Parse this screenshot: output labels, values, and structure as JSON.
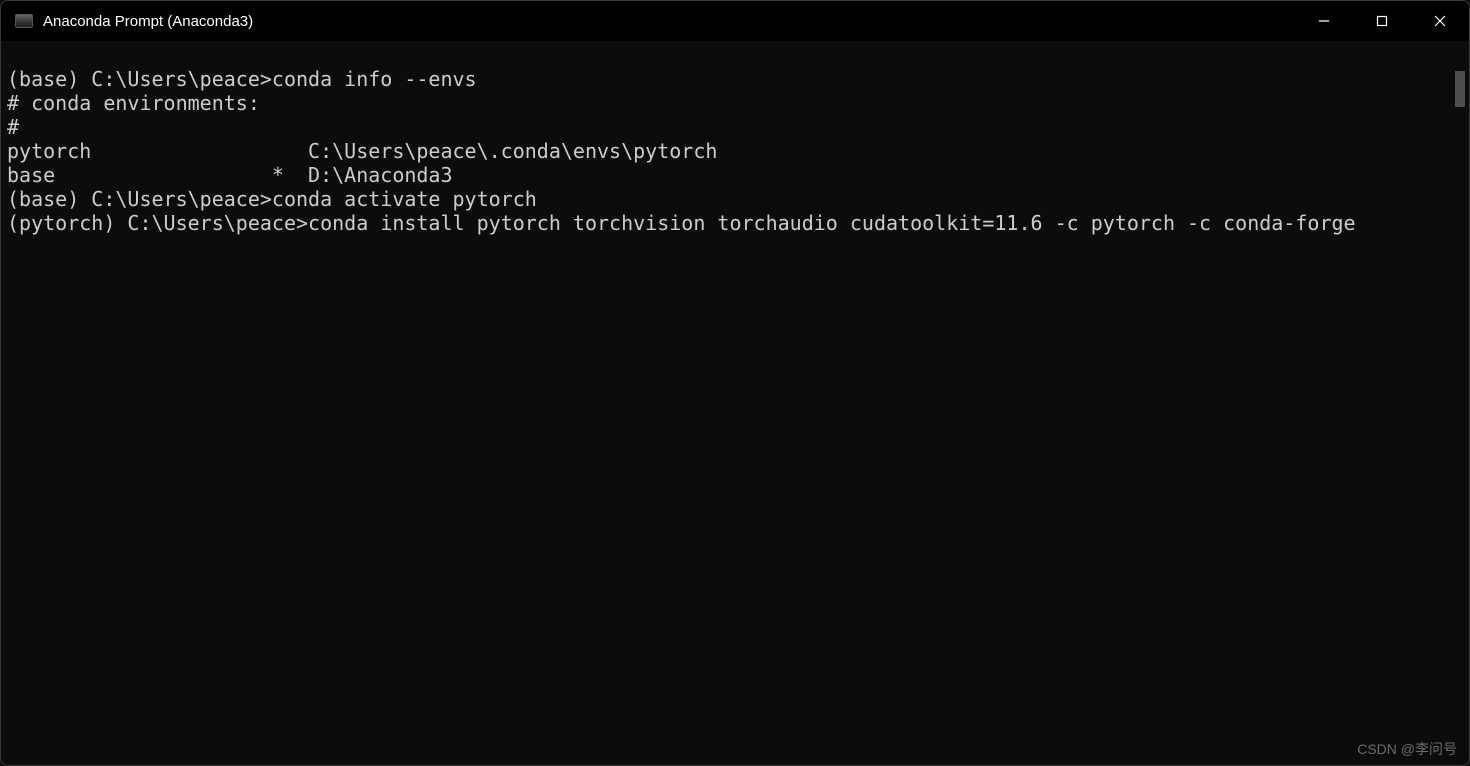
{
  "titlebar": {
    "title": "Anaconda Prompt (Anaconda3)"
  },
  "terminal": {
    "lines": [
      "",
      "(base) C:\\Users\\peace>conda info --envs",
      "# conda environments:",
      "#",
      "pytorch                  C:\\Users\\peace\\.conda\\envs\\pytorch",
      "base                  *  D:\\Anaconda3",
      "",
      "",
      "(base) C:\\Users\\peace>conda activate pytorch",
      "",
      "(pytorch) C:\\Users\\peace>conda install pytorch torchvision torchaudio cudatoolkit=11.6 -c pytorch -c conda-forge"
    ]
  },
  "watermark": "CSDN @李问号"
}
